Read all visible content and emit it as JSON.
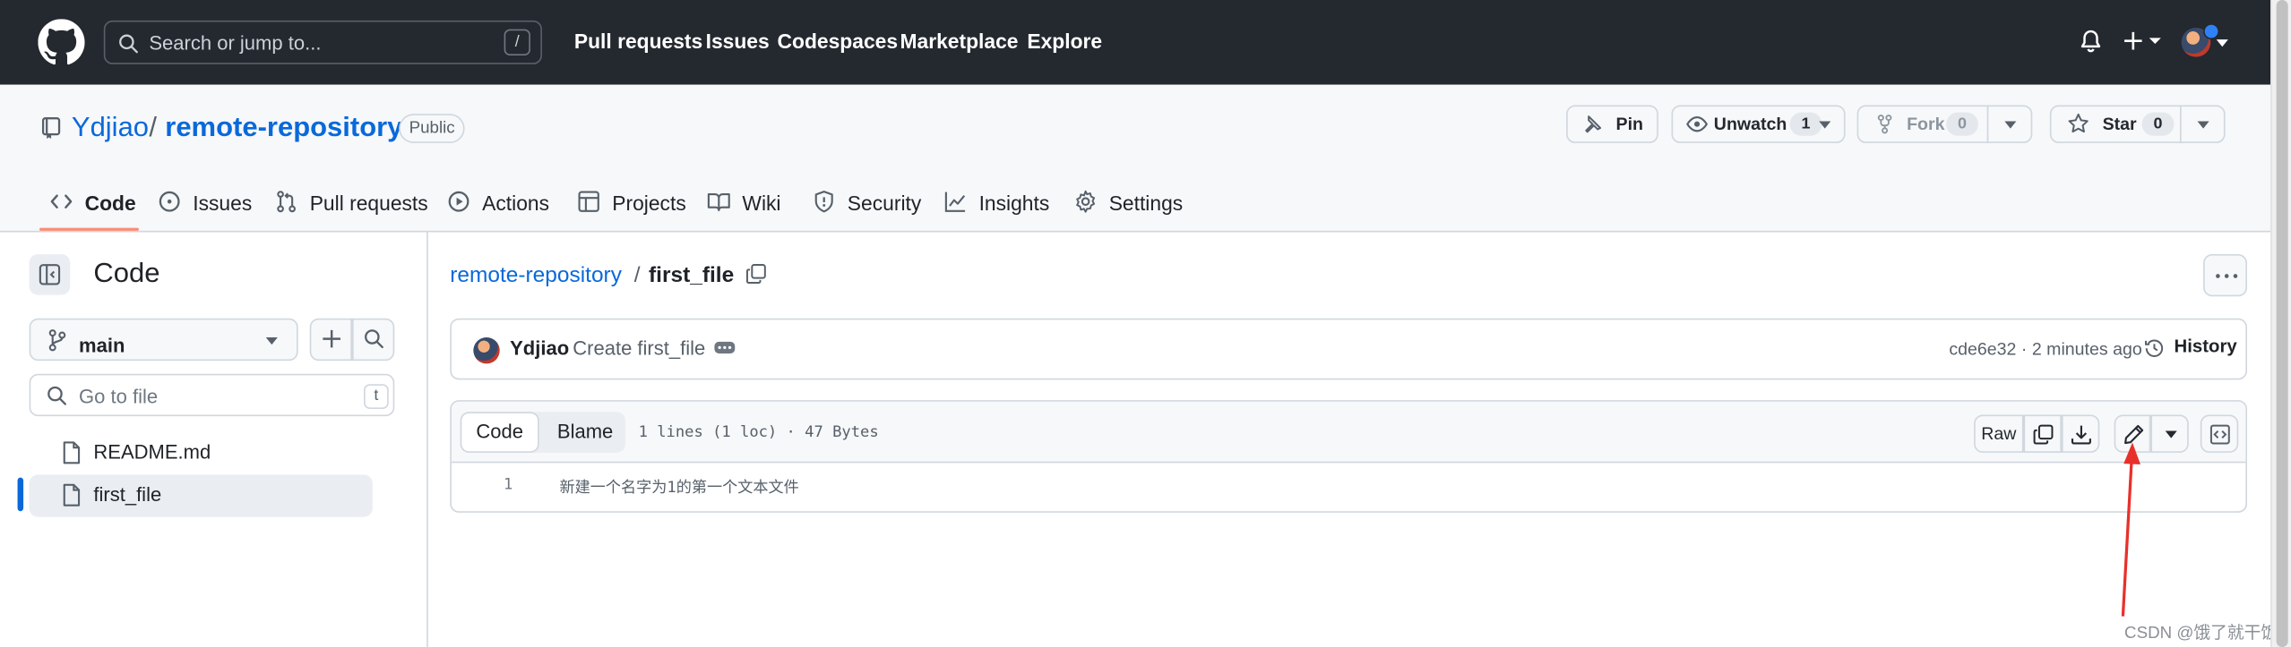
{
  "header": {
    "search_placeholder": "Search or jump to...",
    "search_shortcut": "/",
    "nav": [
      "Pull requests",
      "Issues",
      "Codespaces",
      "Marketplace",
      "Explore"
    ],
    "icons": [
      "github-logo-icon",
      "search-icon",
      "bell-icon",
      "plus-icon",
      "avatar"
    ]
  },
  "repo": {
    "owner": "Ydjiao",
    "separator": "/",
    "name": "remote-repository",
    "visibility": "Public",
    "pin_label": "Pin",
    "watch_label": "Unwatch",
    "watch_count": "1",
    "fork_label": "Fork",
    "fork_count": "0",
    "star_label": "Star",
    "star_count": "0"
  },
  "tabs": [
    {
      "label": "Code",
      "icon": "code-icon",
      "selected": true
    },
    {
      "label": "Issues",
      "icon": "issue-icon"
    },
    {
      "label": "Pull requests",
      "icon": "pull-request-icon"
    },
    {
      "label": "Actions",
      "icon": "play-icon"
    },
    {
      "label": "Projects",
      "icon": "table-icon"
    },
    {
      "label": "Wiki",
      "icon": "book-icon"
    },
    {
      "label": "Security",
      "icon": "shield-icon"
    },
    {
      "label": "Insights",
      "icon": "graph-icon"
    },
    {
      "label": "Settings",
      "icon": "gear-icon"
    }
  ],
  "sidebar": {
    "title": "Code",
    "branch": "main",
    "goto_placeholder": "Go to file",
    "goto_shortcut": "t",
    "files": [
      {
        "name": "README.md",
        "active": false
      },
      {
        "name": "first_file",
        "active": true
      }
    ]
  },
  "breadcrumb": {
    "repo": "remote-repository",
    "separator": "/",
    "file": "first_file"
  },
  "commit": {
    "author": "Ydjiao",
    "message": "Create first_file",
    "meta": "cde6e32 · 2 minutes ago",
    "history_label": "History"
  },
  "file": {
    "code_tab": "Code",
    "blame_tab": "Blame",
    "info": "1 lines (1 loc) · 47 Bytes",
    "raw_label": "Raw",
    "lines": [
      {
        "number": "1",
        "text": "新建一个名字为1的第一个文本文件"
      }
    ]
  },
  "annotation": {
    "arrow_color": "#e8302a",
    "points_to": "edit-file-button"
  },
  "watermark": "CSDN @饿了就干饭",
  "colors": {
    "header_bg": "#24292f",
    "link": "#0969da",
    "tab_underline": "#fd8c73",
    "border": "#d0d7de"
  }
}
